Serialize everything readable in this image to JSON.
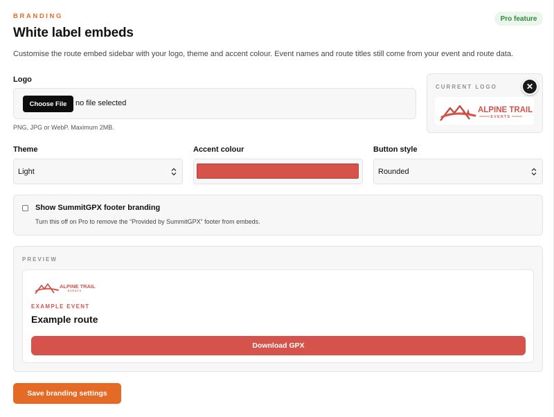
{
  "header": {
    "eyebrow": "BRANDING",
    "title": "White label embeds",
    "badge": "Pro feature",
    "description": "Customise the route embed sidebar with your logo, theme and accent colour. Event names and route titles still come from your event and route data."
  },
  "logo": {
    "label": "Logo",
    "choose_button": "Choose File",
    "file_status": "no file selected",
    "hint": "PNG, JPG or WebP. Maximum 2MB.",
    "current_caption": "CURRENT LOGO",
    "brand_name": "ALPINE TRAIL",
    "brand_sub": "EVENTS",
    "remove_icon": "close-icon"
  },
  "theme": {
    "label": "Theme",
    "value": "Light"
  },
  "accent": {
    "label": "Accent colour",
    "value": "#d5534a"
  },
  "button_style": {
    "label": "Button style",
    "value": "Rounded"
  },
  "footer_branding": {
    "checked": false,
    "label": "Show SummitGPX footer branding",
    "help": "Turn this off on Pro to remove the “Provided by SummitGPX” footer from embeds."
  },
  "preview": {
    "caption": "PREVIEW",
    "event_label": "EXAMPLE EVENT",
    "route_title": "Example route",
    "download_label": "Download GPX"
  },
  "save_button": "Save branding settings",
  "colors": {
    "brand_orange": "#e56a25",
    "accent_red": "#d5534a",
    "pro_green": "#2f8a3c"
  }
}
